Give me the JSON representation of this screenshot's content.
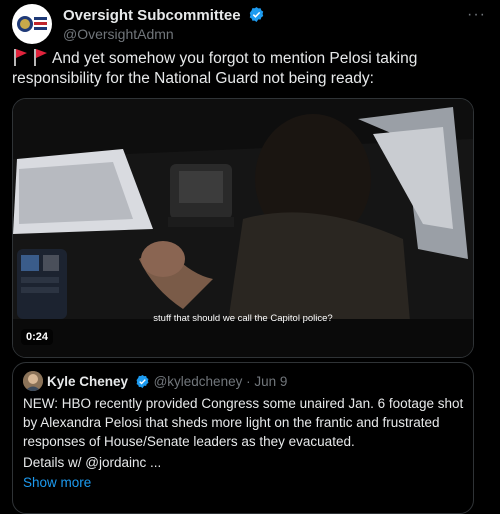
{
  "account": {
    "display_name": "Oversight Subcommittee",
    "handle": "@OversightAdmn"
  },
  "tweet": {
    "text": "And yet somehow you forgot to mention Pelosi taking responsibility for the National Guard not being ready:"
  },
  "video": {
    "caption": "stuff that should we call the Capitol police?",
    "duration": "0:24"
  },
  "quote": {
    "display_name": "Kyle Cheney",
    "handle": "@kyledcheney",
    "date": "· Jun 9",
    "text": "NEW: HBO recently provided Congress some unaired Jan. 6 footage shot by Alexandra Pelosi that sheds more light on the frantic and frustrated responses of House/Senate leaders as they evacuated.",
    "details": "Details w/ @jordainc ...",
    "show_more": "Show more"
  },
  "colors": {
    "background": "#000000",
    "text": "#e7e9ea",
    "muted": "#71767b",
    "link": "#1d9bf0",
    "verified": "#1d9bf0",
    "flag": "#e0233c"
  },
  "icons": [
    "verified-badge-icon",
    "more-options-icon",
    "red-flag-icon"
  ]
}
